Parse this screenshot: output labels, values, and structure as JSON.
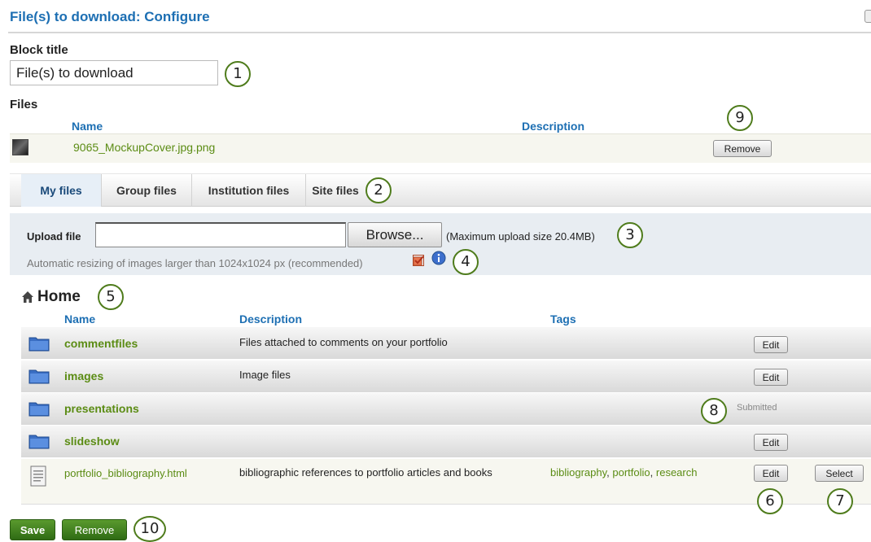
{
  "dialog": {
    "title": "File(s) to download: Configure"
  },
  "block_title": {
    "label": "Block title",
    "value": "File(s) to download"
  },
  "files": {
    "label": "Files",
    "headers": {
      "name": "Name",
      "description": "Description"
    },
    "attached": {
      "name": "9065_MockupCover.jpg.png",
      "remove_label": "Remove"
    }
  },
  "tabs": [
    "My files",
    "Group files",
    "Institution files",
    "Site files"
  ],
  "upload": {
    "label": "Upload file",
    "browse_label": "Browse...",
    "max_size": "(Maximum upload size 20.4MB)",
    "resize_note": "Automatic resizing of images larger than 1024x1024 px (recommended)",
    "resize_checked": true
  },
  "browser": {
    "home_label": "Home",
    "headers": {
      "name": "Name",
      "description": "Description",
      "tags": "Tags"
    },
    "rows": [
      {
        "name": "commentfiles",
        "description": "Files attached to comments on your portfolio",
        "action": "Edit"
      },
      {
        "name": "images",
        "description": "Image files",
        "action": "Edit"
      },
      {
        "name": "presentations",
        "description": "",
        "status": "Submitted"
      },
      {
        "name": "slideshow",
        "description": "",
        "action": "Edit"
      },
      {
        "name": "portfolio_bibliography.html",
        "description": "bibliographic references to portfolio articles and books",
        "tags": [
          "bibliography",
          "portfolio",
          "research"
        ],
        "tag_sep": ",",
        "action": "Edit",
        "select_label": "Select"
      }
    ]
  },
  "footer": {
    "save_label": "Save",
    "remove_label": "Remove"
  },
  "callouts": [
    "1",
    "2",
    "3",
    "4",
    "5",
    "6",
    "7",
    "8",
    "9",
    "10"
  ],
  "colors": {
    "title": "#1d6fb3",
    "link": "#5b8c14",
    "button_primary": "#3f7f1f"
  },
  "icons": [
    "close-icon",
    "image-thumbnail-icon",
    "home-icon",
    "checkbox-checked-icon",
    "info-icon",
    "folder-icon",
    "document-icon"
  ]
}
